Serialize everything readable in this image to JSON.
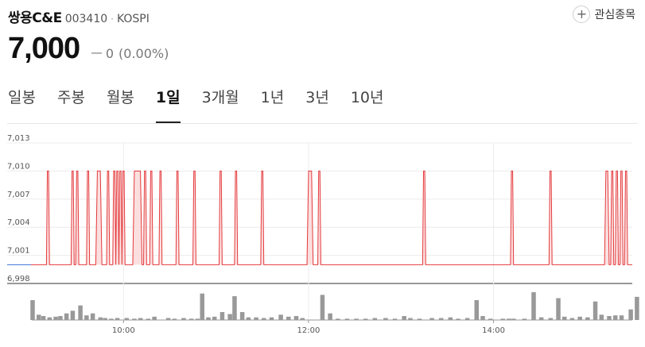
{
  "stock": {
    "name": "쌍용C&E",
    "code": "003410",
    "market": "KOSPI",
    "price": "7,000",
    "change_mark": "ㅡ",
    "change": "0",
    "change_pct": "(0.00%)"
  },
  "watchlist": {
    "label": "관심종목",
    "icon": "plus-icon"
  },
  "tabs": [
    {
      "label": "일봉",
      "active": false
    },
    {
      "label": "주봉",
      "active": false
    },
    {
      "label": "월봉",
      "active": false
    },
    {
      "label": "1일",
      "active": true
    },
    {
      "label": "3개월",
      "active": false
    },
    {
      "label": "1년",
      "active": false
    },
    {
      "label": "3년",
      "active": false
    },
    {
      "label": "10년",
      "active": false
    }
  ],
  "colors": {
    "line": "#e4393c",
    "fill": "#fbdcdc",
    "volume": "#999999",
    "baseline": "#3b6fd6"
  },
  "chart_data": {
    "type": "line",
    "ylim": [
      6998,
      7013
    ],
    "y_ticks": [
      {
        "value": 7013,
        "label": "7,013"
      },
      {
        "value": 7010,
        "label": "7,010"
      },
      {
        "value": 7007,
        "label": "7,007"
      },
      {
        "value": 7004,
        "label": "7,004"
      },
      {
        "value": 7001,
        "label": "7,001"
      },
      {
        "value": 6998,
        "label": "6,998"
      }
    ],
    "x_ticks": [
      {
        "minute": 60,
        "label": "10:00"
      },
      {
        "minute": 180,
        "label": "12:00"
      },
      {
        "minute": 300,
        "label": "14:00"
      }
    ],
    "session": {
      "start": "09:00",
      "end": "15:30",
      "minutes": 390
    },
    "base_price": 7000,
    "peak_price": 7010,
    "spikes": [
      [
        10,
        12
      ],
      [
        26,
        28
      ],
      [
        29,
        31
      ],
      [
        36,
        38
      ],
      [
        42,
        46
      ],
      [
        49,
        51
      ],
      [
        53,
        55
      ],
      [
        55,
        57
      ],
      [
        57,
        59
      ],
      [
        59,
        61
      ],
      [
        66,
        72
      ],
      [
        73,
        75
      ],
      [
        77,
        79
      ],
      [
        83,
        85
      ],
      [
        94,
        96
      ],
      [
        105,
        107
      ],
      [
        122,
        124
      ],
      [
        132,
        134
      ],
      [
        149,
        151
      ],
      [
        179,
        183
      ],
      [
        186,
        188
      ],
      [
        254,
        256
      ],
      [
        311,
        313
      ],
      [
        336,
        338
      ],
      [
        372,
        375
      ],
      [
        376,
        378
      ],
      [
        379,
        381
      ],
      [
        382,
        384
      ],
      [
        385,
        387
      ]
    ],
    "volume": [
      [
        0,
        30
      ],
      [
        4,
        8
      ],
      [
        7,
        6
      ],
      [
        11,
        4
      ],
      [
        15,
        5
      ],
      [
        18,
        6
      ],
      [
        22,
        10
      ],
      [
        26,
        14
      ],
      [
        31,
        22
      ],
      [
        35,
        7
      ],
      [
        39,
        10
      ],
      [
        44,
        4
      ],
      [
        47,
        3
      ],
      [
        51,
        2
      ],
      [
        55,
        3
      ],
      [
        61,
        3
      ],
      [
        66,
        2
      ],
      [
        70,
        3
      ],
      [
        75,
        2
      ],
      [
        79,
        5
      ],
      [
        88,
        3
      ],
      [
        92,
        2
      ],
      [
        98,
        3
      ],
      [
        103,
        2
      ],
      [
        107,
        2
      ],
      [
        110,
        40
      ],
      [
        114,
        4
      ],
      [
        118,
        5
      ],
      [
        123,
        12
      ],
      [
        128,
        9
      ],
      [
        131,
        36
      ],
      [
        136,
        12
      ],
      [
        140,
        4
      ],
      [
        145,
        4
      ],
      [
        150,
        3
      ],
      [
        155,
        4
      ],
      [
        161,
        8
      ],
      [
        166,
        5
      ],
      [
        171,
        6
      ],
      [
        175,
        3
      ],
      [
        188,
        38
      ],
      [
        193,
        10
      ],
      [
        198,
        2
      ],
      [
        204,
        2
      ],
      [
        210,
        2
      ],
      [
        216,
        2
      ],
      [
        222,
        3
      ],
      [
        229,
        3
      ],
      [
        235,
        2
      ],
      [
        241,
        6
      ],
      [
        245,
        3
      ],
      [
        251,
        2
      ],
      [
        259,
        3
      ],
      [
        265,
        3
      ],
      [
        271,
        4
      ],
      [
        276,
        2
      ],
      [
        282,
        3
      ],
      [
        288,
        30
      ],
      [
        292,
        6
      ],
      [
        297,
        2
      ],
      [
        305,
        2
      ],
      [
        309,
        2
      ],
      [
        312,
        2
      ],
      [
        319,
        2
      ],
      [
        325,
        42
      ],
      [
        330,
        4
      ],
      [
        336,
        3
      ],
      [
        341,
        33
      ],
      [
        345,
        5
      ],
      [
        350,
        3
      ],
      [
        355,
        5
      ],
      [
        360,
        4
      ],
      [
        365,
        28
      ],
      [
        369,
        8
      ],
      [
        374,
        6
      ],
      [
        378,
        7
      ],
      [
        382,
        7
      ],
      [
        388,
        16
      ],
      [
        392,
        35
      ]
    ]
  }
}
